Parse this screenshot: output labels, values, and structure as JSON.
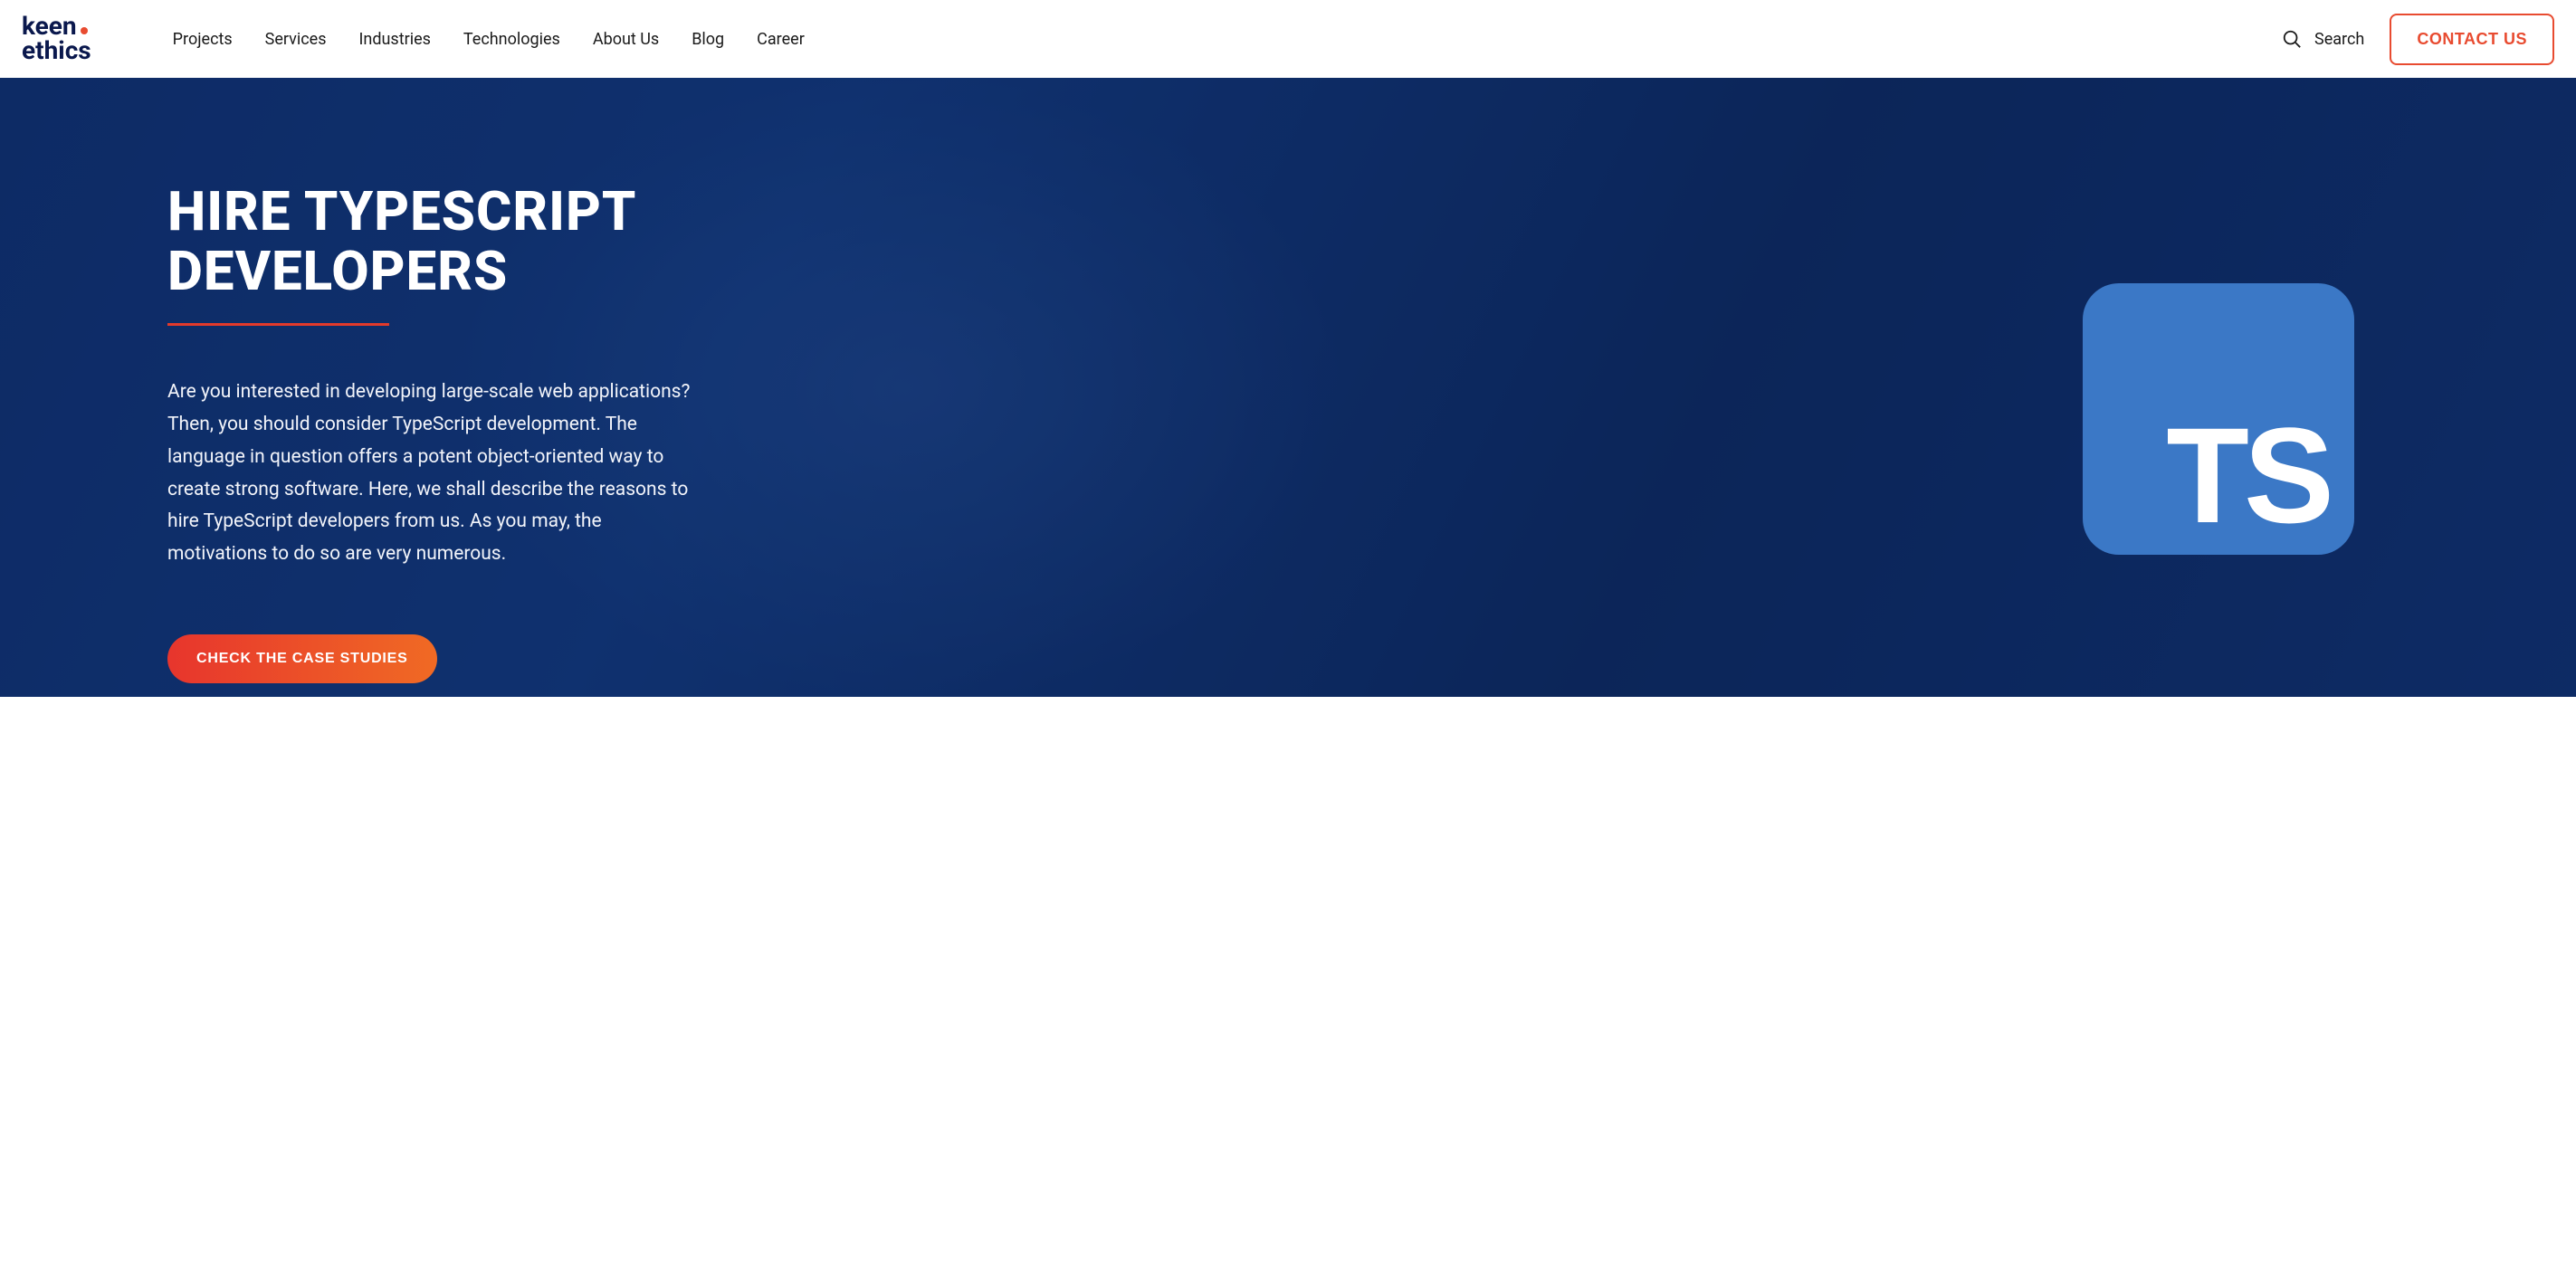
{
  "header": {
    "logo_line1": "keen",
    "logo_line2": "ethics",
    "nav": [
      "Projects",
      "Services",
      "Industries",
      "Technologies",
      "About Us",
      "Blog",
      "Career"
    ],
    "search_label": "Search",
    "contact_label": "CONTACT US"
  },
  "hero": {
    "title": "HIRE TYPESCRIPT DEVELOPERS",
    "description": "Are you interested in developing large-scale web applications? Then, you should consider TypeScript development. The language in question offers a potent object-oriented way to create strong software. Here, we shall describe the reasons to hire TypeScript developers from us. As you may, the motivations to do so are very numerous.",
    "cta_label": "CHECK THE CASE STUDIES",
    "tile_text": "TS"
  },
  "colors": {
    "accent_red": "#e84b30",
    "hero_bg": "#12377c",
    "ts_tile": "#3b78c6"
  }
}
